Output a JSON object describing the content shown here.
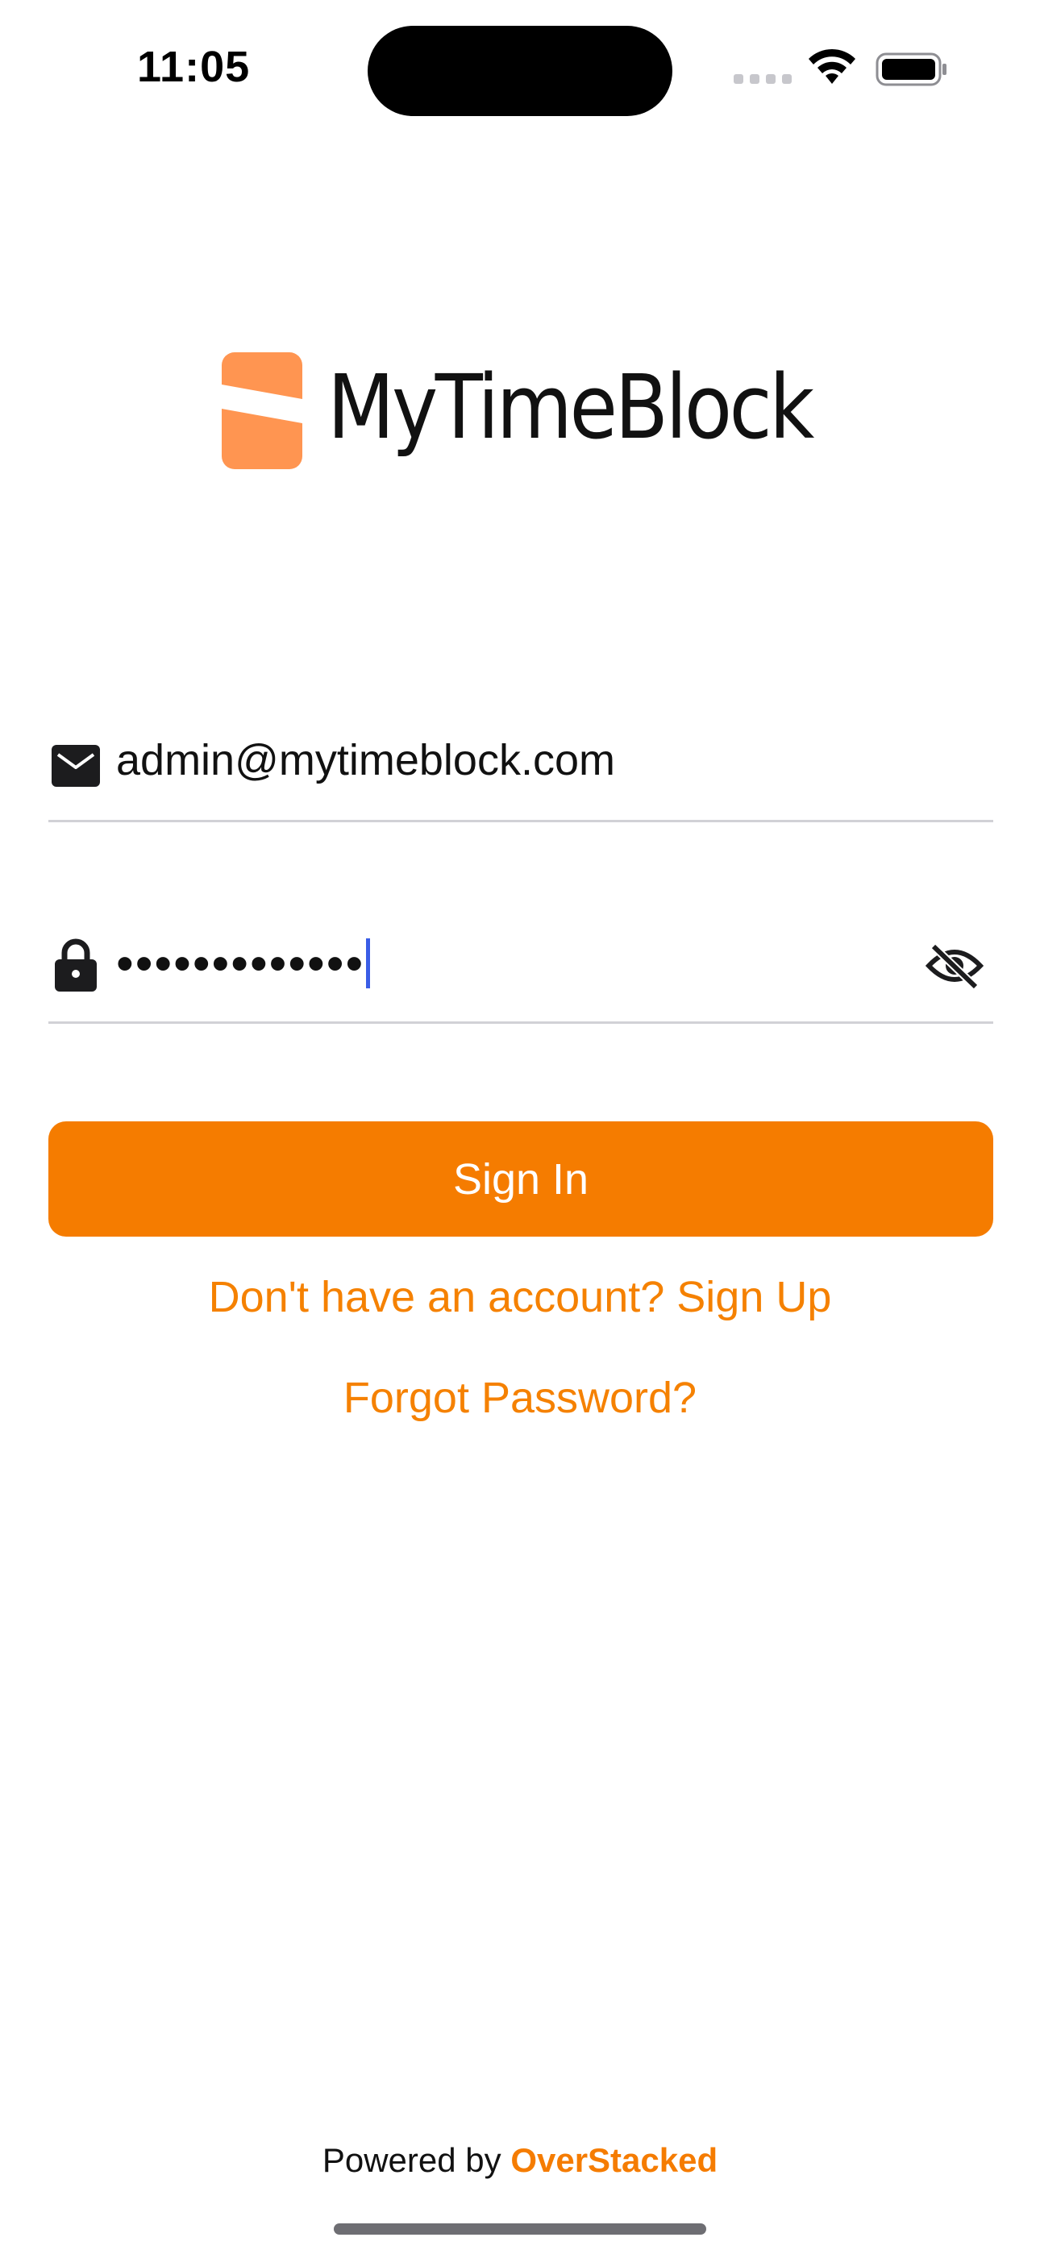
{
  "status_bar": {
    "time": "11:05"
  },
  "logo": {
    "text": "MyTimeBlock",
    "mark_color": "#FF9551"
  },
  "email": {
    "value": "admin@mytimeblock.com",
    "icon": "envelope-icon"
  },
  "password": {
    "masked_value": "•••••••••••••",
    "icon": "lock-icon",
    "toggle_icon": "eye-slash-icon"
  },
  "signin": {
    "label": "Sign In",
    "color": "#F57C00"
  },
  "links": {
    "signup": "Don't have an account? Sign Up",
    "forgot": "Forgot Password?"
  },
  "footer": {
    "prefix": "Powered by",
    "brand": "OverStacked"
  }
}
